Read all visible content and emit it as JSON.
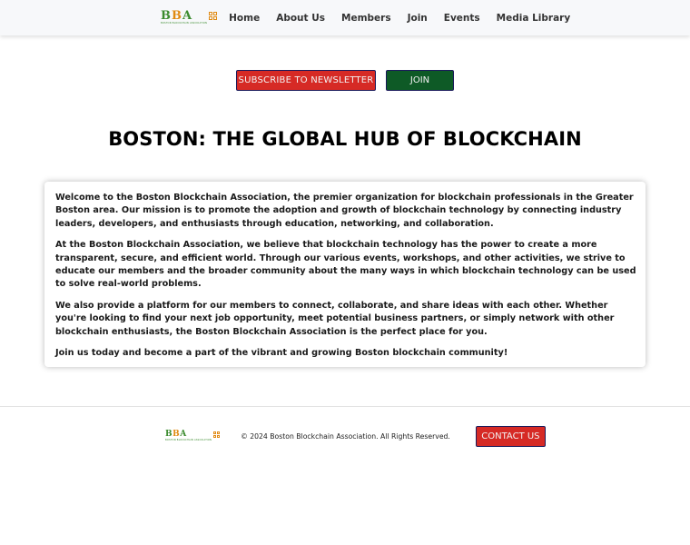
{
  "nav": {
    "logo": {
      "letters": [
        "B",
        "B",
        "A"
      ],
      "tagline": "BOSTON BLOCKCHAIN ASSOCIATION",
      "colors": {
        "green": "#3b8b2e",
        "orange": "#e08a12"
      }
    },
    "links": [
      "Home",
      "About Us",
      "Members",
      "Join",
      "Events",
      "Media Library"
    ]
  },
  "actions": {
    "subscribe_label": "SUBSCRIBE TO NEWSLETTER",
    "join_label": "JOIN",
    "subscribe_color": "#d62a25",
    "join_color": "#0e5a26"
  },
  "hero": {
    "title": "BOSTON: THE GLOBAL HUB OF BLOCKCHAIN"
  },
  "intro": {
    "paragraphs": [
      "Welcome to the Boston Blockchain Association, the premier organization for blockchain professionals in the Greater Boston area. Our mission is to promote the adoption and growth of blockchain technology by connecting industry leaders, developers, and enthusiasts through education, networking, and collaboration.",
      "At the Boston Blockchain Association, we believe that blockchain technology has the power to create a more transparent, secure, and efficient world. Through our various events, workshops, and other activities, we strive to educate our members and the broader community about the many ways in which blockchain technology can be used to solve real-world problems.",
      "We also provide a platform for our members to connect, collaborate, and share ideas with each other. Whether you're looking to find your next job opportunity, meet potential business partners, or simply network with other blockchain enthusiasts, the Boston Blockchain Association is the perfect place for you.",
      "Join us today and become a part of the vibrant and growing Boston blockchain community!"
    ]
  },
  "footer": {
    "copyright": "© 2024 Boston Blockchain Association. All Rights Reserved.",
    "contact_label": "CONTACT US"
  }
}
